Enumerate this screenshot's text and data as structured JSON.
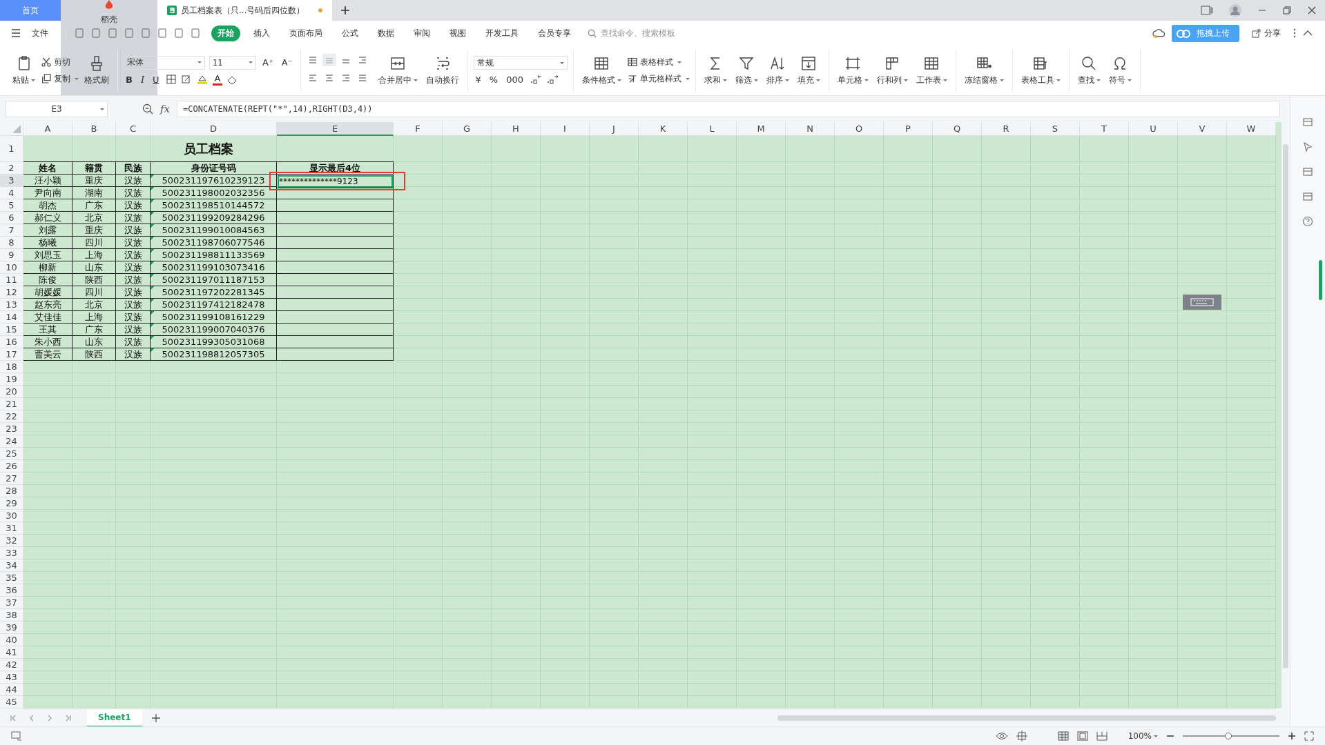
{
  "tabs": [
    {
      "kind": "home",
      "label": "首页",
      "selected": false
    },
    {
      "kind": "app",
      "label": "稻壳",
      "selected": false
    },
    {
      "kind": "document",
      "label": "员工档案表（只...号码后四位数）",
      "selected": true,
      "modified": true
    }
  ],
  "menu": [
    {
      "label": "文件",
      "selected": false
    },
    {
      "label": "开始",
      "selected": true
    },
    {
      "label": "插入",
      "selected": false
    },
    {
      "label": "页面布局",
      "selected": false
    },
    {
      "label": "公式",
      "selected": false
    },
    {
      "label": "数据",
      "selected": false
    },
    {
      "label": "审阅",
      "selected": false
    },
    {
      "label": "视图",
      "selected": false
    },
    {
      "label": "开发工具",
      "selected": false
    },
    {
      "label": "会员专享",
      "selected": false
    }
  ],
  "command_search": {
    "placeholder": "查找命令、搜索模板"
  },
  "upload_popup": {
    "label": "拖拽上传"
  },
  "share": {
    "label": "分享"
  },
  "toolbar": [
    [
      {
        "kind": "big",
        "label": "粘贴",
        "dropdown": true
      },
      {
        "kind": "pair",
        "items": [
          {
            "label": "剪切",
            "dropdown": false
          },
          {
            "label": "复制",
            "dropdown": true
          }
        ]
      },
      {
        "kind": "big",
        "label": "格式刷",
        "dropdown": false
      }
    ],
    [
      {
        "kind": "font",
        "family": "宋体",
        "size": "11",
        "size_buttons": [
          "A⁺",
          "A⁻"
        ],
        "styles": [
          "B",
          "I",
          "U"
        ],
        "font_color": "A"
      }
    ],
    [
      {
        "kind": "align"
      },
      {
        "kind": "big",
        "label": "合并居中",
        "dropdown": true
      },
      {
        "kind": "big",
        "label": "自动换行",
        "dropdown": false
      }
    ],
    [
      {
        "kind": "number",
        "format": "常规",
        "buttons": [
          "¥",
          "%",
          "000"
        ]
      }
    ],
    [
      {
        "kind": "big",
        "label": "条件格式",
        "dropdown": true
      },
      {
        "kind": "pair",
        "items": [
          {
            "label": "表格样式",
            "dropdown": true
          },
          {
            "label": "单元格样式",
            "dropdown": true
          }
        ]
      }
    ],
    [
      {
        "kind": "big",
        "label": "求和",
        "dropdown": true
      },
      {
        "kind": "big",
        "label": "筛选",
        "dropdown": true
      },
      {
        "kind": "big",
        "label": "排序",
        "dropdown": true
      },
      {
        "kind": "big",
        "label": "填充",
        "dropdown": true
      }
    ],
    [
      {
        "kind": "big",
        "label": "单元格",
        "dropdown": true
      },
      {
        "kind": "big",
        "label": "行和列",
        "dropdown": true
      },
      {
        "kind": "big",
        "label": "工作表",
        "dropdown": true
      }
    ],
    [
      {
        "kind": "big",
        "label": "冻结窗格",
        "dropdown": true
      }
    ],
    [
      {
        "kind": "big",
        "label": "表格工具",
        "dropdown": true
      }
    ],
    [
      {
        "kind": "big",
        "label": "查找",
        "dropdown": true
      },
      {
        "kind": "big",
        "label": "符号",
        "dropdown": true
      }
    ]
  ],
  "formula_bar": {
    "name_box": "E3",
    "fx_label": "fx",
    "formula": "=CONCATENATE(REPT(\"*\",14),RIGHT(D3,4))"
  },
  "columns": [
    {
      "label": "A",
      "selected": false
    },
    {
      "label": "B",
      "selected": false
    },
    {
      "label": "C",
      "selected": false
    },
    {
      "label": "D",
      "selected": false
    },
    {
      "label": "E",
      "selected": true
    },
    {
      "label": "F",
      "selected": false
    },
    {
      "label": "G",
      "selected": false
    },
    {
      "label": "H",
      "selected": false
    },
    {
      "label": "I",
      "selected": false
    },
    {
      "label": "J",
      "selected": false
    },
    {
      "label": "K",
      "selected": false
    },
    {
      "label": "L",
      "selected": false
    },
    {
      "label": "M",
      "selected": false
    },
    {
      "label": "N",
      "selected": false
    },
    {
      "label": "O",
      "selected": false
    },
    {
      "label": "P",
      "selected": false
    },
    {
      "label": "Q",
      "selected": false
    },
    {
      "label": "R",
      "selected": false
    },
    {
      "label": "S",
      "selected": false
    },
    {
      "label": "T",
      "selected": false
    },
    {
      "label": "U",
      "selected": false
    },
    {
      "label": "V",
      "selected": false
    },
    {
      "label": "W",
      "selected": false
    }
  ],
  "row_numbers": [
    "1",
    "2",
    "3",
    "4",
    "5",
    "6",
    "7",
    "8",
    "9",
    "10",
    "11",
    "12",
    "13",
    "14",
    "15",
    "16",
    "17",
    "18",
    "19",
    "20",
    "21",
    "22",
    "23",
    "24",
    "25",
    "26",
    "27",
    "28",
    "29",
    "30",
    "31",
    "32",
    "33",
    "34",
    "35",
    "36",
    "37",
    "38",
    "39",
    "40",
    "41",
    "42",
    "43",
    "44",
    "45"
  ],
  "table": {
    "title": "员工档案",
    "headers": [
      "姓名",
      "籍贯",
      "民族",
      "身份证号码",
      "显示最后4位"
    ],
    "rows": [
      {
        "name": "汪小颖",
        "origin": "重庆",
        "ethnicity": "汉族",
        "id_number": "500231197610239123",
        "masked": "**************9123",
        "selected": true
      },
      {
        "name": "尹向南",
        "origin": "湖南",
        "ethnicity": "汉族",
        "id_number": "500231198002032356",
        "selected": false
      },
      {
        "name": "胡杰",
        "origin": "广东",
        "ethnicity": "汉族",
        "id_number": "500231198510144572",
        "selected": false
      },
      {
        "name": "郝仁义",
        "origin": "北京",
        "ethnicity": "汉族",
        "id_number": "500231199209284296",
        "selected": false
      },
      {
        "name": "刘露",
        "origin": "重庆",
        "ethnicity": "汉族",
        "id_number": "500231199010084563",
        "selected": false
      },
      {
        "name": "杨曦",
        "origin": "四川",
        "ethnicity": "汉族",
        "id_number": "500231198706077546",
        "selected": false
      },
      {
        "name": "刘思玉",
        "origin": "上海",
        "ethnicity": "汉族",
        "id_number": "500231198811133569",
        "selected": false
      },
      {
        "name": "柳新",
        "origin": "山东",
        "ethnicity": "汉族",
        "id_number": "500231199103073416",
        "selected": false
      },
      {
        "name": "陈俊",
        "origin": "陕西",
        "ethnicity": "汉族",
        "id_number": "500231197011187153",
        "selected": false
      },
      {
        "name": "胡媛媛",
        "origin": "四川",
        "ethnicity": "汉族",
        "id_number": "500231197202281345",
        "selected": false
      },
      {
        "name": "赵东亮",
        "origin": "北京",
        "ethnicity": "汉族",
        "id_number": "500231197412182478",
        "selected": false
      },
      {
        "name": "艾佳佳",
        "origin": "上海",
        "ethnicity": "汉族",
        "id_number": "500231199108161229",
        "selected": false
      },
      {
        "name": "王其",
        "origin": "广东",
        "ethnicity": "汉族",
        "id_number": "500231199007040376",
        "selected": false
      },
      {
        "name": "朱小西",
        "origin": "山东",
        "ethnicity": "汉族",
        "id_number": "500231199305031068",
        "selected": false
      },
      {
        "name": "曹美云",
        "origin": "陕西",
        "ethnicity": "汉族",
        "id_number": "500231198812057305",
        "selected": false
      }
    ]
  },
  "sheets": [
    {
      "label": "Sheet1",
      "selected": true
    }
  ],
  "zoom": {
    "label": "100%",
    "level": 0.47
  }
}
